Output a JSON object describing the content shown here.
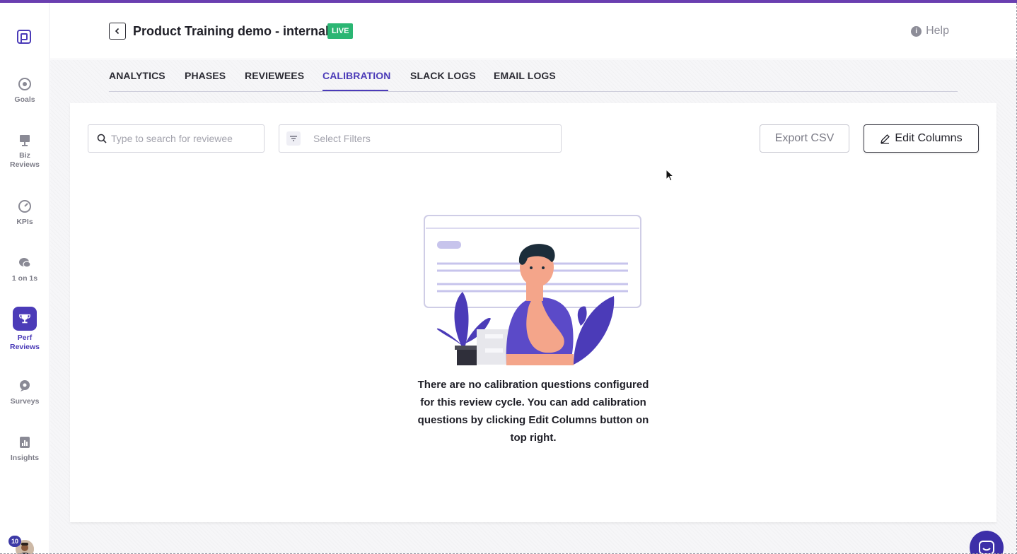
{
  "app": {
    "accent_color": "#4b3bb8",
    "live_color": "#2bb673"
  },
  "sidebar": {
    "logo_icon": "app-logo-icon",
    "items": [
      {
        "label": "Goals",
        "icon": "target-icon"
      },
      {
        "label": "Biz\nReviews",
        "icon": "presentation-icon"
      },
      {
        "label": "KPIs",
        "icon": "gauge-icon"
      },
      {
        "label": "1 on 1s",
        "icon": "chat-icon"
      },
      {
        "label": "Perf\nReviews",
        "icon": "trophy-icon",
        "active": true
      },
      {
        "label": "Surveys",
        "icon": "survey-icon"
      },
      {
        "label": "Insights",
        "icon": "insights-icon"
      }
    ],
    "notification_count": "10"
  },
  "header": {
    "title": "Product Training demo - internal",
    "status_badge": "LIVE",
    "help_label": "Help"
  },
  "tabs": [
    {
      "label": "ANALYTICS"
    },
    {
      "label": "PHASES"
    },
    {
      "label": "REVIEWEES"
    },
    {
      "label": "CALIBRATION",
      "active": true
    },
    {
      "label": "SLACK LOGS"
    },
    {
      "label": "EMAIL LOGS"
    }
  ],
  "toolbar": {
    "search_placeholder": "Type to search for reviewee",
    "filter_placeholder": "Select Filters",
    "export_label": "Export CSV",
    "edit_label": "Edit Columns"
  },
  "empty_state": {
    "message": "There are no calibration questions configured for this review cycle. You can add calibration questions by clicking Edit Columns button on top right."
  }
}
